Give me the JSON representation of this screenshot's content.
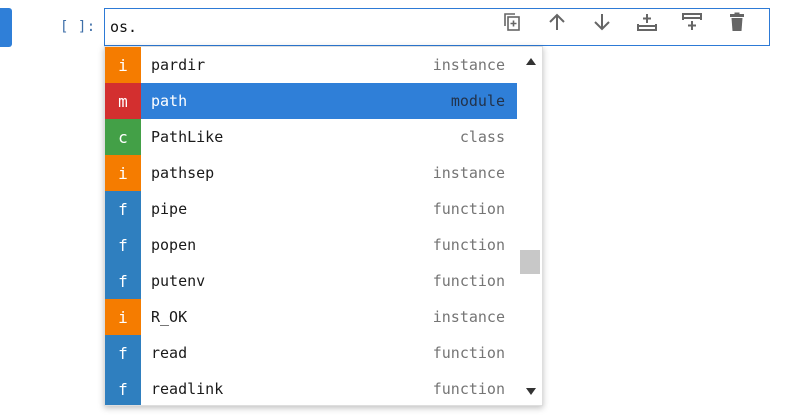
{
  "cell": {
    "prompt": "[ ]:",
    "code": "os."
  },
  "toolbar": {
    "buttons": [
      {
        "name": "duplicate-cell",
        "icon": "copy-icon"
      },
      {
        "name": "move-up",
        "icon": "arrow-up-icon"
      },
      {
        "name": "move-down",
        "icon": "arrow-down-icon"
      },
      {
        "name": "insert-above",
        "icon": "insert-above-icon"
      },
      {
        "name": "insert-below",
        "icon": "insert-below-icon"
      },
      {
        "name": "delete-cell",
        "icon": "trash-icon"
      }
    ]
  },
  "completer": {
    "items": [
      {
        "badge": "i",
        "name": "pardir",
        "kind": "instance",
        "color": "#f57c00"
      },
      {
        "badge": "m",
        "name": "path",
        "kind": "module",
        "color": "#d32f2f",
        "active": true
      },
      {
        "badge": "c",
        "name": "PathLike",
        "kind": "class",
        "color": "#43a047"
      },
      {
        "badge": "i",
        "name": "pathsep",
        "kind": "instance",
        "color": "#f57c00"
      },
      {
        "badge": "f",
        "name": "pipe",
        "kind": "function",
        "color": "#2f7fbf"
      },
      {
        "badge": "f",
        "name": "popen",
        "kind": "function",
        "color": "#2f7fbf"
      },
      {
        "badge": "f",
        "name": "putenv",
        "kind": "function",
        "color": "#2f7fbf"
      },
      {
        "badge": "i",
        "name": "R_OK",
        "kind": "instance",
        "color": "#f57c00"
      },
      {
        "badge": "f",
        "name": "read",
        "kind": "function",
        "color": "#2f7fbf"
      },
      {
        "badge": "f",
        "name": "readlink",
        "kind": "function",
        "color": "#2f7fbf"
      }
    ]
  },
  "colors": {
    "accent": "#2f7fd8",
    "instance": "#f57c00",
    "module": "#d32f2f",
    "class": "#43a047",
    "function": "#2f7fbf"
  }
}
